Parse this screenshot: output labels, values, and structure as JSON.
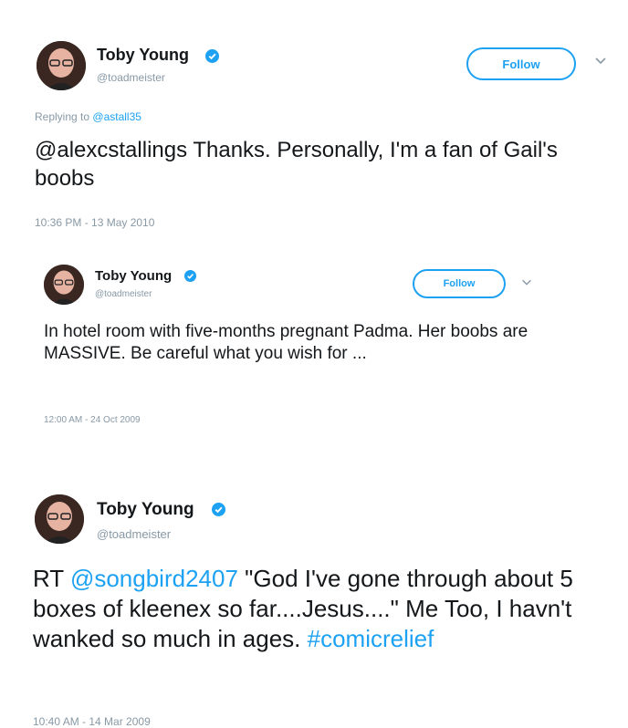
{
  "colors": {
    "accent": "#1da1f2",
    "muted": "#8899a6",
    "text": "#14171a"
  },
  "icons": {
    "verified": "verified-badge-icon",
    "chevron": "chevron-down-icon"
  },
  "tweets": [
    {
      "name": "Toby Young",
      "handle": "@toadmeister",
      "follow_label": "Follow",
      "reply_prefix": "Replying to",
      "reply_handle": "@astall35",
      "text": "@alexcstallings Thanks. Personally, I'm a fan of Gail's boobs",
      "timestamp": "10:36 PM - 13 May 2010"
    },
    {
      "name": "Toby Young",
      "handle": "@toadmeister",
      "follow_label": "Follow",
      "text": "In hotel room with five-months pregnant Padma. Her boobs are MASSIVE. Be careful what you wish for ...",
      "timestamp": "12:00 AM - 24 Oct 2009"
    },
    {
      "name": "Toby Young",
      "handle": "@toadmeister",
      "text_prefix": "RT",
      "mention": "@songbird2407",
      "text_main": "\"God I've gone through about 5 boxes of kleenex so far....Jesus....\" Me Too, I havn't wanked so much in ages.",
      "hashtag": "#comicrelief",
      "timestamp": "10:40 AM - 14 Mar 2009"
    }
  ]
}
